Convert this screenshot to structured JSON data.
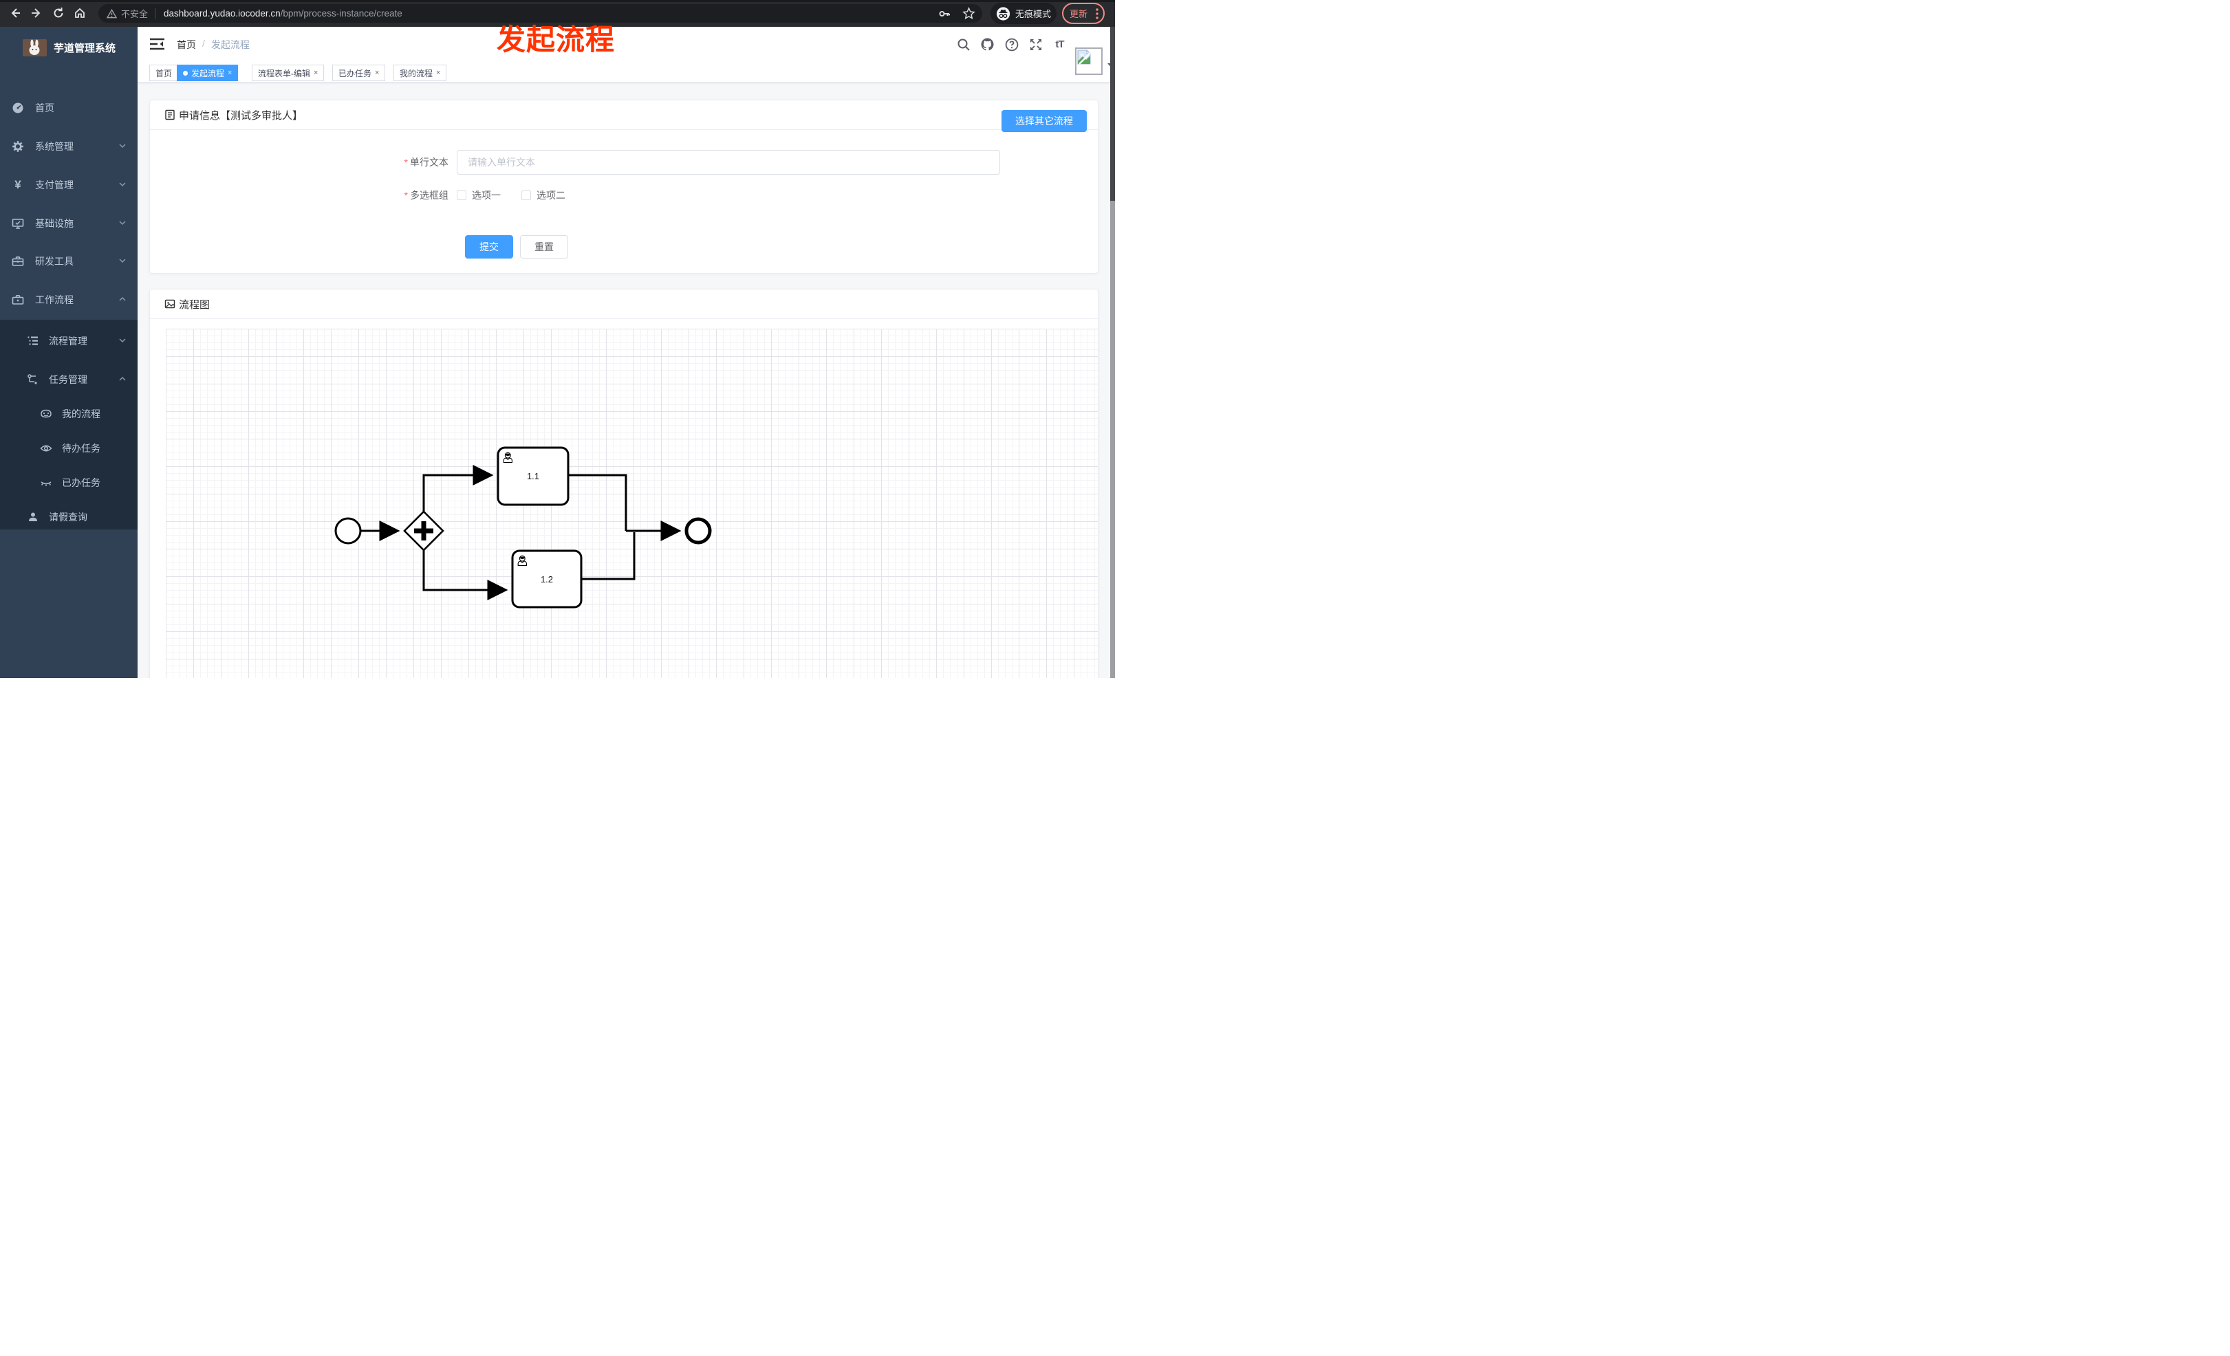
{
  "browser": {
    "security_label": "不安全",
    "url_domain": "dashboard.yudao.iocoder.cn",
    "url_path": "/bpm/process-instance/create",
    "incognito_label": "无痕模式",
    "update_label": "更新"
  },
  "annotation": {
    "title": "发起流程",
    "color": "#ff3300"
  },
  "sidebar": {
    "app_title": "芋道管理系统",
    "items": [
      {
        "label": "首页"
      },
      {
        "label": "系统管理"
      },
      {
        "label": "支付管理"
      },
      {
        "label": "基础设施"
      },
      {
        "label": "研发工具"
      },
      {
        "label": "工作流程"
      }
    ],
    "workflow_children": [
      {
        "label": "流程管理"
      },
      {
        "label": "任务管理"
      }
    ],
    "task_children": [
      {
        "label": "我的流程"
      },
      {
        "label": "待办任务"
      },
      {
        "label": "已办任务"
      }
    ],
    "leave_item": {
      "label": "请假查询"
    }
  },
  "header": {
    "breadcrumb_home": "首页",
    "breadcrumb_current": "发起流程"
  },
  "tabs": [
    {
      "label": "首页"
    },
    {
      "label": "发起流程"
    },
    {
      "label": "流程表单-编辑"
    },
    {
      "label": "已办任务"
    },
    {
      "label": "我的流程"
    }
  ],
  "form_card": {
    "title": "申请信息【测试多审批人】",
    "select_other_button": "选择其它流程",
    "fields": {
      "text": {
        "required": "*",
        "label": "单行文本",
        "placeholder": "请输入单行文本"
      },
      "checkbox": {
        "required": "*",
        "label": "多选框组",
        "options": [
          {
            "label": "选项一"
          },
          {
            "label": "选项二"
          }
        ]
      }
    },
    "submit_label": "提交",
    "reset_label": "重置"
  },
  "diagram_card": {
    "title": "流程图",
    "nodes": {
      "task1": "1.1",
      "task2": "1.2"
    }
  },
  "ui": {
    "close_glyph": "×",
    "breadcrumb_sep": "/",
    "currency_icon": "¥",
    "font_size_icon": "tT"
  },
  "colors": {
    "accent": "#409eff",
    "danger": "#f56c6c",
    "update_accent": "#f28b82",
    "sidebar_bg": "#304156",
    "submenu_bg": "#1f2d3d"
  }
}
